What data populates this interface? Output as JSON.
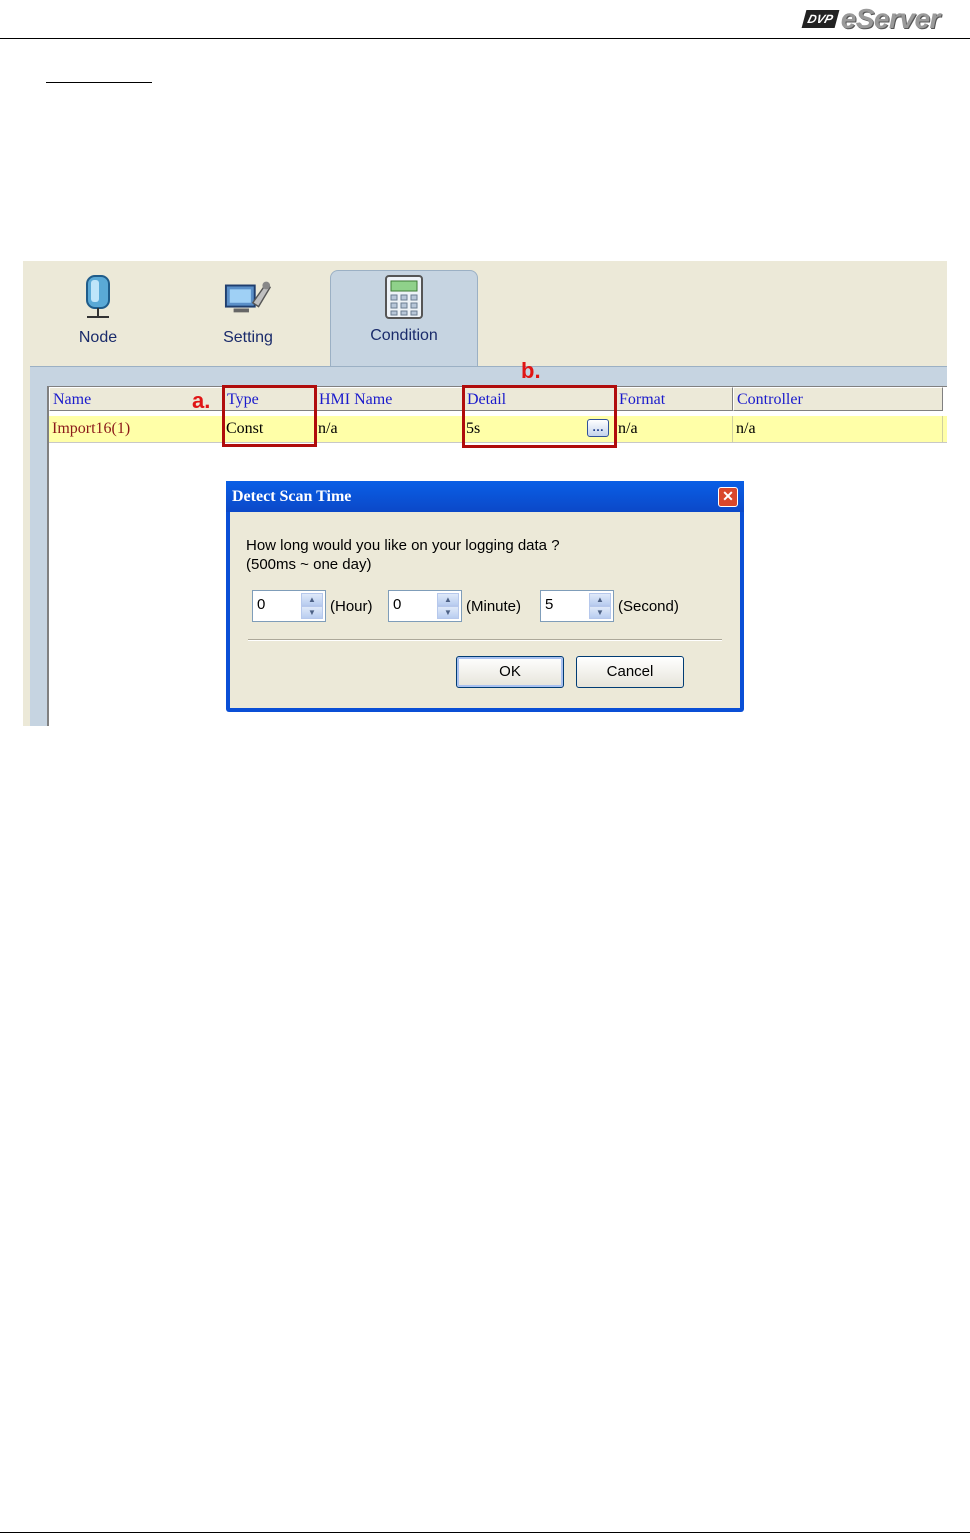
{
  "header": {
    "brand_badge": "DVP",
    "brand_name": "eServer"
  },
  "tabs": [
    {
      "label": "Node",
      "icon": "node-icon"
    },
    {
      "label": "Setting",
      "icon": "setting-icon"
    },
    {
      "label": "Condition",
      "icon": "condition-icon"
    }
  ],
  "grid": {
    "columns": [
      "Name",
      "Type",
      "HMI Name",
      "Detail",
      "Format",
      "Controller"
    ],
    "rows": [
      {
        "name": "Import16(1)",
        "type": "Const",
        "hmi_name": "n/a",
        "detail": "5s",
        "format": "n/a",
        "controller": "n/a"
      }
    ]
  },
  "annotations": {
    "a": "a.",
    "b": "b."
  },
  "dialog": {
    "title": "Detect Scan Time",
    "question": "How long would you like on your logging data ?",
    "range": "(500ms ~  one day)",
    "hour_value": "0",
    "hour_unit": "(Hour)",
    "minute_value": "0",
    "minute_unit": "(Minute)",
    "second_value": "5",
    "second_unit": "(Second)",
    "ok_label": "OK",
    "cancel_label": "Cancel"
  },
  "colors": {
    "annotation": "#e01515",
    "highlight_box": "#b00c0c",
    "row_selected": "#ffffa8",
    "titlebar": "#0a4fd6"
  }
}
